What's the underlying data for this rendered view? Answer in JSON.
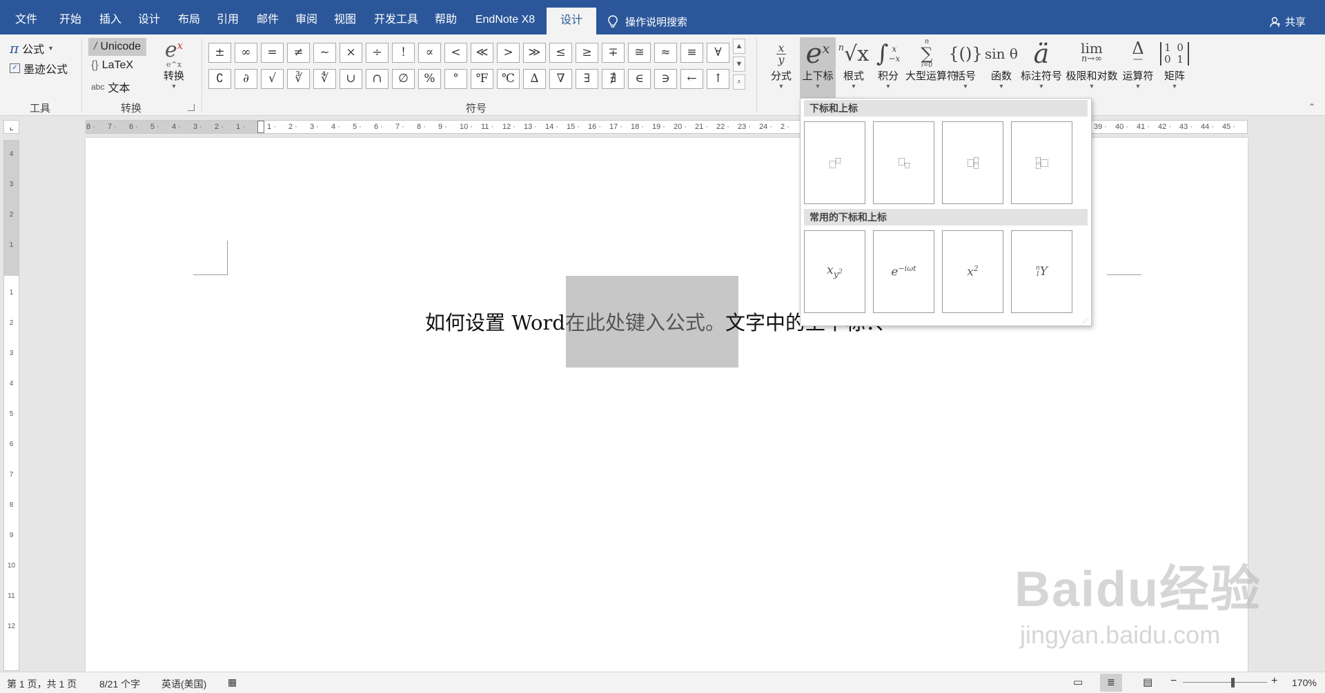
{
  "menu": {
    "tabs": [
      "文件",
      "开始",
      "插入",
      "设计",
      "布局",
      "引用",
      "邮件",
      "审阅",
      "视图",
      "开发工具",
      "帮助",
      "EndNote X8",
      "设计"
    ],
    "tell_me": "操作说明搜索",
    "share": "共享"
  },
  "ribbon": {
    "tools_group": {
      "equation": "公式",
      "ink_equation": "墨迹公式",
      "label": "工具"
    },
    "convert_group": {
      "unicode": "Unicode",
      "latex": "LaTeX",
      "text": "文本",
      "convert": "转换",
      "label": "转换"
    },
    "symbols_group": {
      "label": "符号",
      "row1": [
        "±",
        "∞",
        "=",
        "≠",
        "~",
        "×",
        "÷",
        "!",
        "∝",
        "<",
        "≪",
        ">",
        "≫",
        "≤",
        "≥",
        "∓",
        "≅",
        "≈",
        "≡",
        "∀"
      ],
      "row2": [
        "∁",
        "∂",
        "√",
        "∛",
        "∜",
        "∪",
        "∩",
        "∅",
        "%",
        "°",
        "℉",
        "℃",
        "∆",
        "∇",
        "∃",
        "∄",
        "∈",
        "∋",
        "←",
        "↑"
      ]
    },
    "structures": [
      {
        "key": "fraction",
        "label": "分式"
      },
      {
        "key": "script",
        "label": "上下标"
      },
      {
        "key": "radical",
        "label": "根式"
      },
      {
        "key": "integral",
        "label": "积分"
      },
      {
        "key": "large_operator",
        "label": "大型运算符"
      },
      {
        "key": "bracket",
        "label": "括号"
      },
      {
        "key": "function",
        "label": "函数"
      },
      {
        "key": "accent",
        "label": "标注符号"
      },
      {
        "key": "limit_log",
        "label": "极限和对数"
      },
      {
        "key": "operator",
        "label": "运算符"
      },
      {
        "key": "matrix",
        "label": "矩阵"
      }
    ]
  },
  "glyphs": {
    "script": "e",
    "script_sup": "x",
    "radical_index": "n",
    "radical_body": "√x",
    "integral": "∫",
    "integral_upper": "x",
    "integral_lower": "−x",
    "large_operator": "∑",
    "large_operator_upper": "n",
    "large_operator_lower": "i=0",
    "bracket": "{()}",
    "function": "sin θ",
    "accent": "ä",
    "limit": "lim",
    "limit_sub": "n→∞",
    "operator": "Δ",
    "operator_arrow": "—",
    "matrix": [
      "1 0",
      "0 1"
    ],
    "convert": "e",
    "convert_sup": "x",
    "convert_small": "e^x"
  },
  "dropdown": {
    "section1": "下标和上标",
    "section2": "常用的下标和上标",
    "common": [
      {
        "base": "x",
        "sub": "y",
        "subsup": "2"
      },
      {
        "base": "e",
        "sup": "−iωt"
      },
      {
        "base": "x",
        "sup": "2"
      },
      {
        "presup": "n",
        "presub": "1",
        "base": "Y"
      }
    ]
  },
  "document": {
    "text_before": "如何设置 Word",
    "equation_placeholder": "在此处键入公式。",
    "text_after": "文字中的上下标：、"
  },
  "status": {
    "page": "第 1 页，共 1 页",
    "words": "8/21 个字",
    "language": "英语(美国)",
    "zoom": "170%"
  },
  "ruler": {
    "left_numbers": [
      "8",
      "7",
      "6",
      "5",
      "4",
      "3",
      "2",
      "1"
    ],
    "right_numbers": [
      "1",
      "2",
      "3",
      "4",
      "5",
      "6",
      "7",
      "8",
      "9",
      "10",
      "11",
      "12",
      "13",
      "14",
      "15",
      "16",
      "17",
      "18",
      "19",
      "20",
      "21",
      "22",
      "23",
      "24",
      "2"
    ],
    "far_numbers": [
      "39",
      "40",
      "41",
      "42",
      "43",
      "44",
      "45"
    ],
    "vertical_numbers": [
      "4",
      "3",
      "2",
      "1",
      "1",
      "2",
      "3",
      "4",
      "5",
      "6",
      "7",
      "8",
      "9",
      "10",
      "11",
      "12"
    ]
  },
  "watermark": {
    "logo": "Baidu经验",
    "url": "jingyan.baidu.com"
  }
}
